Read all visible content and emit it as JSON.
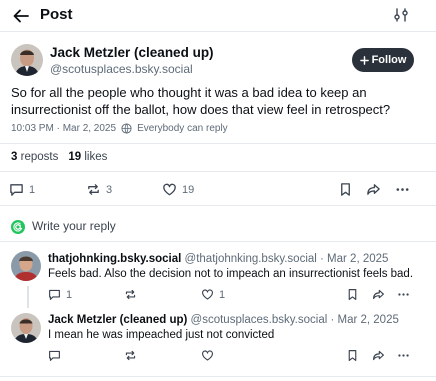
{
  "header": {
    "title": "Post"
  },
  "post": {
    "author_name": "Jack Metzler (cleaned up)",
    "author_handle": "@scotusplaces.bsky.social",
    "follow_label": "Follow",
    "text": "So for all the people who thought it was a bad idea to keep an insurrectionist off the ballot, how does that view feel in retrospect?",
    "timestamp": "10:03 PM · Mar 2, 2025",
    "reply_permission": "Everybody can reply",
    "reposts_count": "3",
    "reposts_label": "reposts",
    "likes_count": "19",
    "likes_label": "likes",
    "actions": {
      "replies": "1",
      "reposts": "3",
      "likes": "19"
    }
  },
  "composer": {
    "placeholder": "Write your reply",
    "accent": "#22c55e"
  },
  "replies": [
    {
      "author_name": "thatjohnking.bsky.social",
      "meta": "@thatjohnking.bsky.social · Mar 2, 2025",
      "text": "Feels bad. Also the decision not to impeach an insurrectionist feels bad.",
      "actions": {
        "replies": "1",
        "reposts": "",
        "likes": "1"
      }
    },
    {
      "author_name": "Jack Metzler (cleaned up)",
      "meta": "@scotusplaces.bsky.social · Mar 2, 2025",
      "text": "I mean he was impeached just not convicted",
      "actions": {
        "replies": "",
        "reposts": "",
        "likes": ""
      }
    }
  ],
  "colors": {
    "text": "#0b0f14",
    "muted": "#5e6b78",
    "follow_bg": "#2a313a",
    "divider": "#e6e9ee"
  }
}
